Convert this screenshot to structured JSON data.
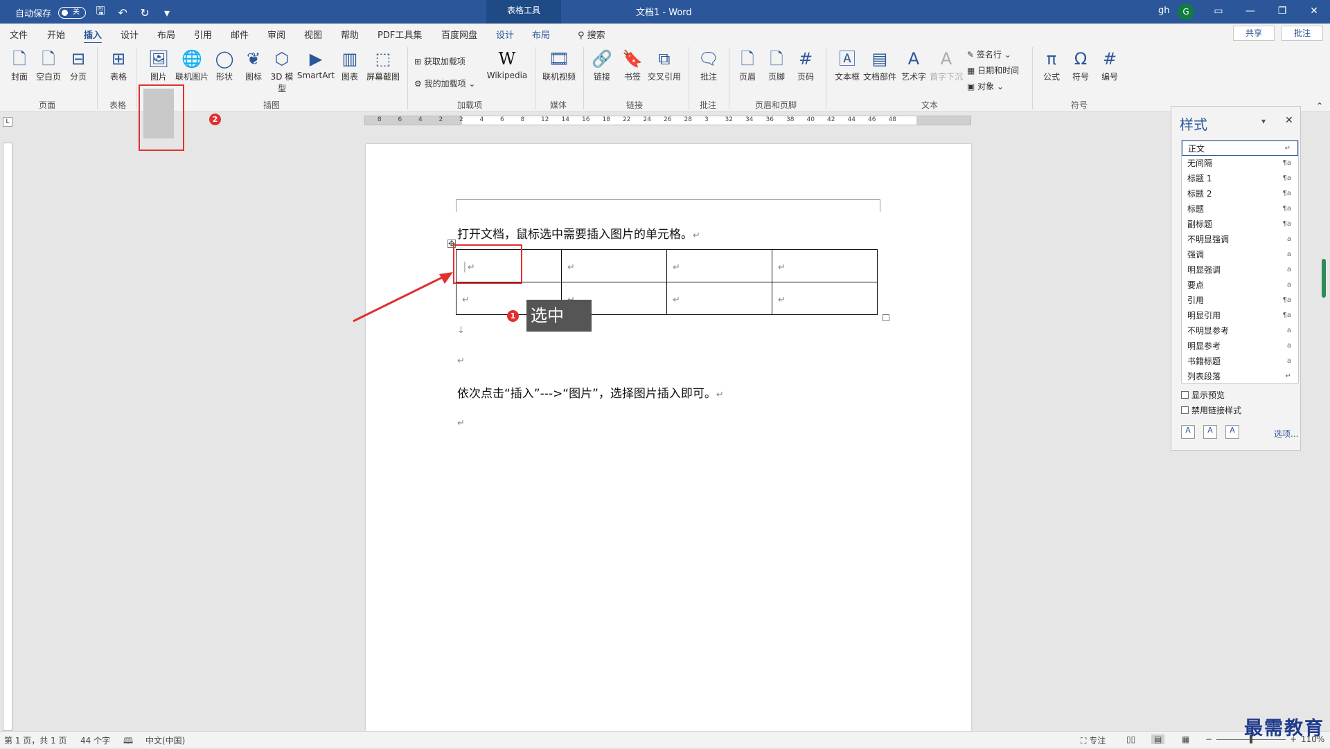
{
  "titlebar": {
    "autosave_label": "自动保存",
    "autosave_state": "关",
    "context_tab": "表格工具",
    "doc_title": "文档1 - Word",
    "user": "gh",
    "avatar_letter": "G"
  },
  "tabs": [
    "文件",
    "开始",
    "插入",
    "设计",
    "布局",
    "引用",
    "邮件",
    "审阅",
    "视图",
    "帮助",
    "PDF工具集",
    "百度网盘",
    "设计",
    "布局"
  ],
  "search_label": "搜索",
  "share_label": "共享",
  "comment_label": "批注",
  "ribbon": {
    "pages": [
      "封面",
      "空白页",
      "分页"
    ],
    "table": "表格",
    "illustrations": [
      "图片",
      "联机图片",
      "形状",
      "图标",
      "3D 模型",
      "SmartArt",
      "图表",
      "屏幕截图"
    ],
    "addins": [
      "获取加载项",
      "我的加载项",
      "Wikipedia"
    ],
    "media": "联机视频",
    "links": [
      "链接",
      "书签",
      "交叉引用"
    ],
    "comment": "批注",
    "header_footer": [
      "页眉",
      "页脚",
      "页码"
    ],
    "text": [
      "文本框",
      "文档部件",
      "艺术字",
      "首字下沉"
    ],
    "text_small": [
      "签名行",
      "日期和时间",
      "对象"
    ],
    "symbols": [
      "公式",
      "符号",
      "编号"
    ],
    "group_labels": [
      "页面",
      "表格",
      "插图",
      "加载项",
      "媒体",
      "链接",
      "批注",
      "页眉和页脚",
      "文本",
      "符号"
    ],
    "badge_2": "2"
  },
  "ruler_numbers": [
    "8",
    "6",
    "4",
    "2",
    "2",
    "4",
    "6",
    "8",
    "12",
    "14",
    "16",
    "18",
    "22",
    "24",
    "26",
    "28",
    "3",
    "32",
    "34",
    "36",
    "38",
    "40",
    "42",
    "44",
    "46",
    "48"
  ],
  "document": {
    "line1": "打开文档，鼠标选中需要插入图片的单元格。",
    "line2": "依次点击“插入”--->“图片”，选择图片插入即可。",
    "tooltip": "选中",
    "badge_1": "1"
  },
  "styles_pane": {
    "title": "样式",
    "items": [
      {
        "name": "正文",
        "sym": "↵"
      },
      {
        "name": "无间隔",
        "sym": "¶a"
      },
      {
        "name": "标题 1",
        "sym": "¶a"
      },
      {
        "name": "标题 2",
        "sym": "¶a"
      },
      {
        "name": "标题",
        "sym": "¶a"
      },
      {
        "name": "副标题",
        "sym": "¶a"
      },
      {
        "name": "不明显强调",
        "sym": "a"
      },
      {
        "name": "强调",
        "sym": "a"
      },
      {
        "name": "明显强调",
        "sym": "a"
      },
      {
        "name": "要点",
        "sym": "a"
      },
      {
        "name": "引用",
        "sym": "¶a"
      },
      {
        "name": "明显引用",
        "sym": "¶a"
      },
      {
        "name": "不明显参考",
        "sym": "a"
      },
      {
        "name": "明显参考",
        "sym": "a"
      },
      {
        "name": "书籍标题",
        "sym": "a"
      },
      {
        "name": "列表段落",
        "sym": "↵"
      }
    ],
    "show_preview": "显示预览",
    "disable_linked": "禁用链接样式",
    "options": "选项..."
  },
  "statusbar": {
    "page": "第 1 页，共 1 页",
    "words": "44 个字",
    "lang": "中文(中国)",
    "focus": "专注",
    "zoom": "110%"
  },
  "watermark": "最需教育",
  "colors": {
    "accent": "#2b579a",
    "highlight": "#e03030"
  }
}
